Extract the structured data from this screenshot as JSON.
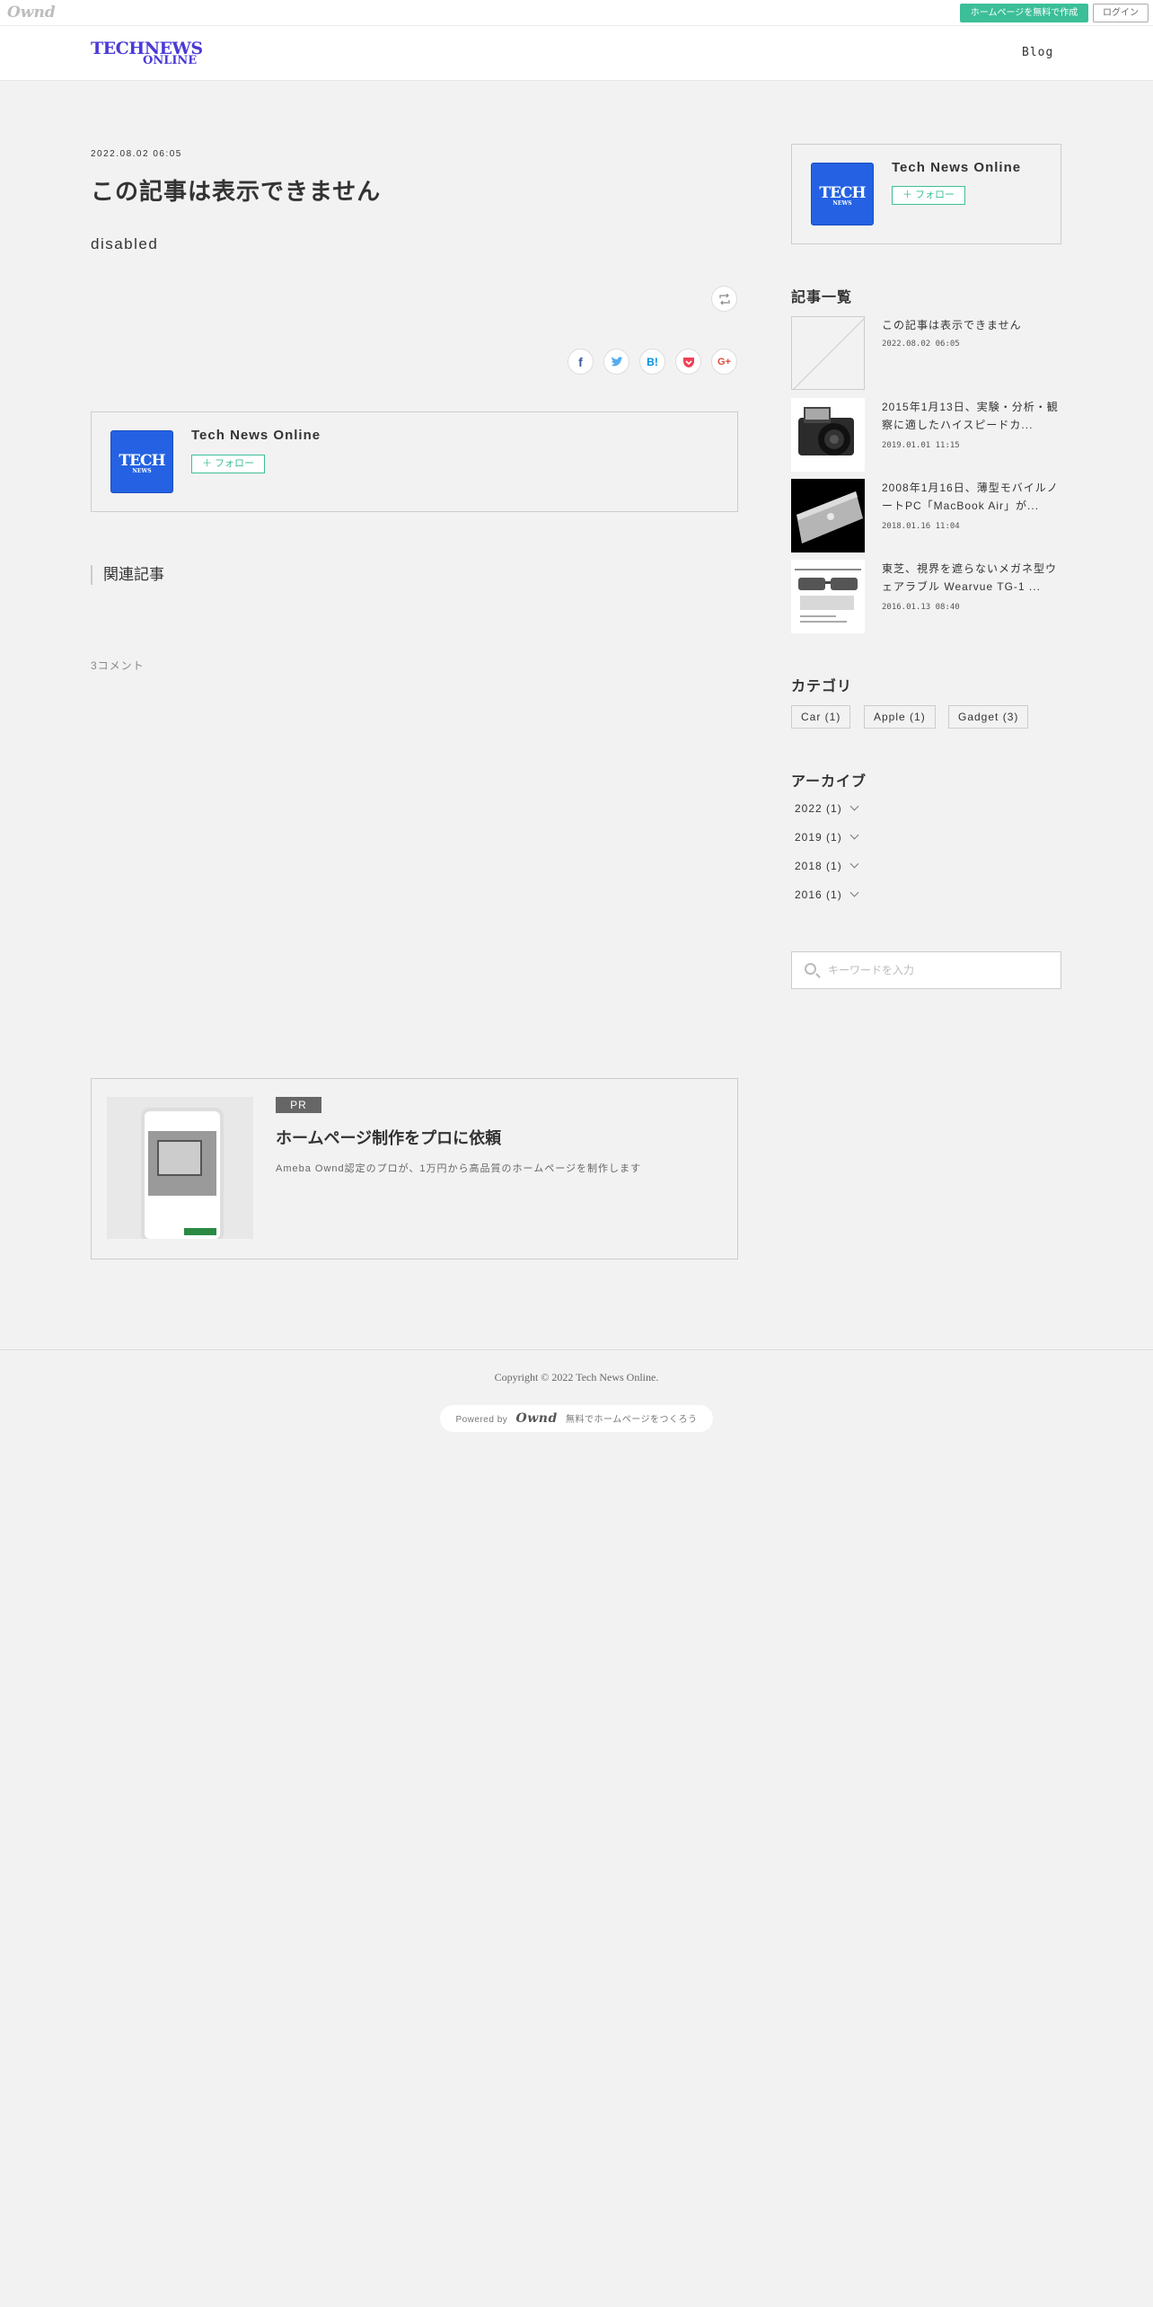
{
  "ownd_bar": {
    "logo": "Ownd",
    "create_label": "ホームページを無料で作成",
    "login_label": "ログイン"
  },
  "header": {
    "logo_line1": "TECHNEWS",
    "logo_line2": "ONLINE",
    "nav_blog": "Blog"
  },
  "article": {
    "date": "2022.08.02 06:05",
    "title": "この記事は表示できません",
    "body": "disabled",
    "share_buttons": [
      "facebook-icon",
      "twitter-icon",
      "hatena-bookmark-icon",
      "pocket-icon",
      "google-plus-icon"
    ]
  },
  "author": {
    "name": "Tech News Online",
    "follow_label": "フォロー",
    "avatar_line1": "TECH",
    "avatar_line2": "NEWS"
  },
  "related": {
    "title": "関連記事"
  },
  "comments": {
    "count_label": "3コメント"
  },
  "pr": {
    "badge": "PR",
    "title": "ホームページ制作をプロに依頼",
    "description": "Ameba Ownd認定のプロが、1万円から高品質のホームページを制作します"
  },
  "sidebar": {
    "profile": {
      "name": "Tech News Online",
      "follow_label": "フォロー"
    },
    "recent_heading": "記事一覧",
    "recent": [
      {
        "title": "この記事は表示できません",
        "date": "2022.08.02 06:05"
      },
      {
        "title": "2015年1月13日、実験・分析・観察に適したハイスピードカ...",
        "date": "2019.01.01 11:15"
      },
      {
        "title": "2008年1月16日、薄型モバイルノートPC「MacBook Air」が...",
        "date": "2018.01.16 11:04"
      },
      {
        "title": "東芝、視界を遮らないメガネ型ウェアラブル Wearvue TG-1 ...",
        "date": "2016.01.13 08:40"
      }
    ],
    "category_heading": "カテゴリ",
    "categories": [
      "Car (1)",
      "Apple (1)",
      "Gadget (3)"
    ],
    "archive_heading": "アーカイブ",
    "archives": [
      "2022 (1)",
      "2019 (1)",
      "2018 (1)",
      "2016 (1)"
    ],
    "search_placeholder": "キーワードを入力"
  },
  "footer": {
    "copyright": "Copyright © 2022 Tech News Online.",
    "powered_prefix": "Powered by",
    "powered_logo": "Ownd",
    "powered_suffix": "無料でホームページをつくろう"
  }
}
